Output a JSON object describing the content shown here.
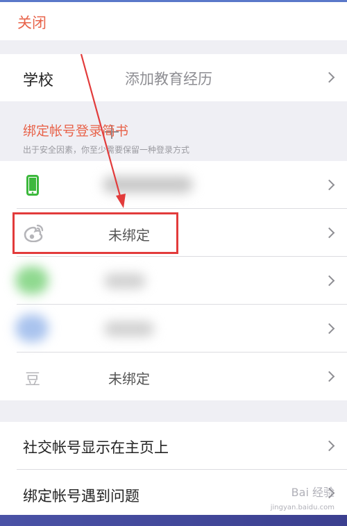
{
  "header": {
    "close_label": "关闭"
  },
  "school": {
    "label": "学校",
    "action_label": "添加教育经历"
  },
  "bind_section": {
    "title": "绑定帐号登录简书",
    "subtitle": "出于安全因素，你至少需要保留一种登录方式",
    "accounts": [
      {
        "icon": "phone-icon",
        "status": ""
      },
      {
        "icon": "weibo-icon",
        "status": "未绑定"
      },
      {
        "icon": "wechat-icon",
        "status": ""
      },
      {
        "icon": "qq-icon",
        "status": ""
      },
      {
        "icon": "douban-icon",
        "icon_text": "豆",
        "status": "未绑定"
      }
    ]
  },
  "settings": {
    "show_on_homepage": "社交帐号显示在主页上",
    "binding_problem": "绑定帐号遇到问题"
  },
  "watermark": {
    "text": "Bai 经验",
    "sub": "jingyan.baidu.com"
  },
  "colors": {
    "accent": "#e8634a",
    "highlight": "#e23b3b",
    "phone_green": "#3cb83c"
  }
}
